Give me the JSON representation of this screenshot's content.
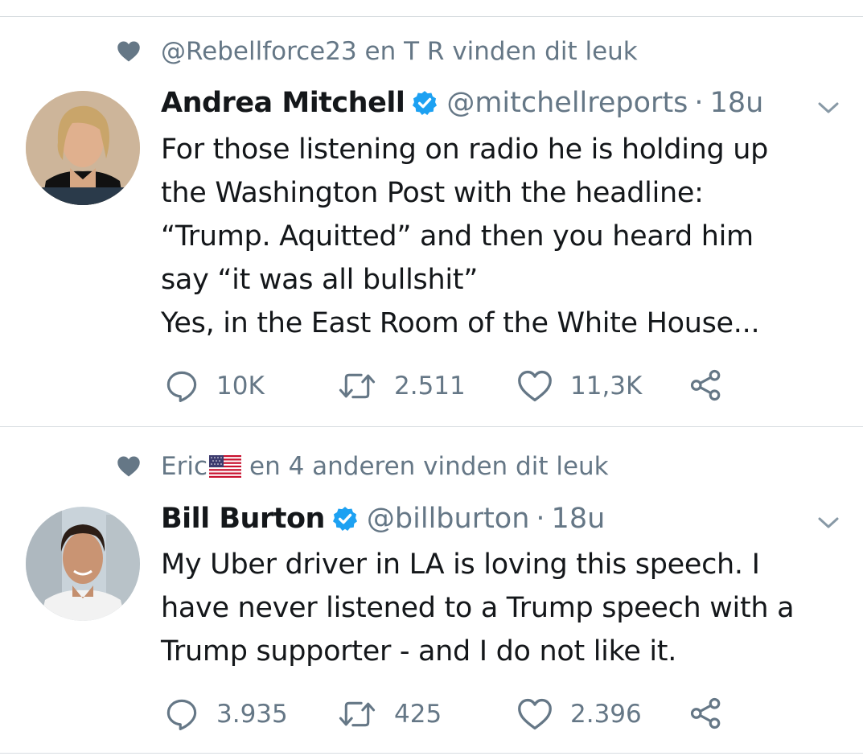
{
  "tweets": [
    {
      "social_context": "@Rebellforce23 en T R vinden dit leuk",
      "author_name": "Andrea Mitchell",
      "handle": "@mitchellreports",
      "separator": "·",
      "time": "18u",
      "text": "For those listening on radio he is holding up\nthe Washington Post with the headline:\n“Trump. Aquitted” and then you heard him\nsay “it was all bullshit”\nYes, in the East Room of the White House...",
      "replies": "10K",
      "retweets": "2.511",
      "likes": "11,3K"
    },
    {
      "social_context_name": "Eric",
      "social_context_rest": "en 4 anderen vinden dit leuk",
      "author_name": "Bill Burton",
      "handle": "@billburton",
      "separator": "·",
      "time": "18u",
      "text": "My Uber driver in LA is loving this speech. I\nhave never listened to a Trump speech with a\nTrump supporter - and I do not like it.",
      "replies": "3.935",
      "retweets": "425",
      "likes": "2.396"
    }
  ],
  "colors": {
    "text_primary": "#14171a",
    "text_secondary": "#657786",
    "verified_blue": "#1da1f2",
    "divider": "#d8dde1"
  },
  "icons": [
    "heart-icon",
    "verified-badge-icon",
    "chevron-down-icon",
    "reply-icon",
    "retweet-icon",
    "like-icon",
    "share-icon",
    "us-flag-icon"
  ]
}
